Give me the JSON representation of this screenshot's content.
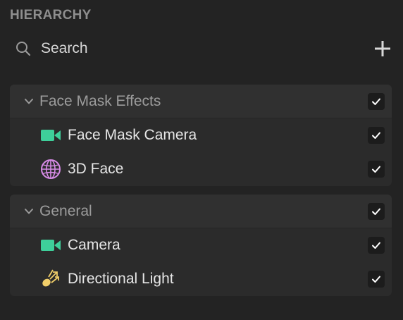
{
  "panel": {
    "title": "HIERARCHY"
  },
  "search": {
    "placeholder": "Search"
  },
  "groups": [
    {
      "label": "Face Mask Effects",
      "checked": true,
      "items": [
        {
          "label": "Face Mask Camera",
          "icon": "camera-icon",
          "checked": true
        },
        {
          "label": "3D Face",
          "icon": "face-mesh-icon",
          "checked": true
        }
      ]
    },
    {
      "label": "General",
      "checked": true,
      "items": [
        {
          "label": "Camera",
          "icon": "camera-icon",
          "checked": true
        },
        {
          "label": "Directional Light",
          "icon": "directional-light-icon",
          "checked": true
        }
      ]
    }
  ],
  "colors": {
    "background": "#232323",
    "group_background": "#2b2b2b",
    "camera_icon": "#3ecf9a",
    "face_icon": "#d78be6",
    "light_icon": "#f2cf6a"
  }
}
